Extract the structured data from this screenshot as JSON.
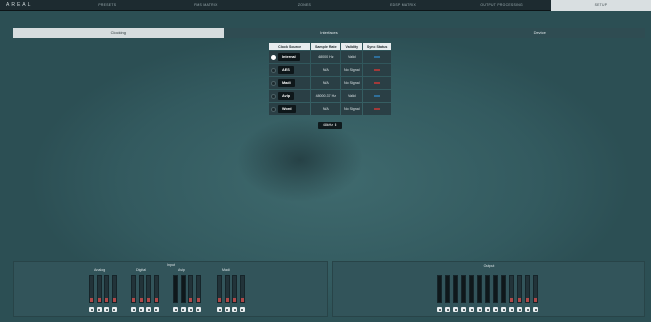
{
  "brand": "AREAL",
  "nav": {
    "tabs": [
      "PRESETS",
      "FMS MATRIX",
      "ZONES",
      "EDSP MATRIX",
      "OUTPUT PROCESSING",
      "SETUP"
    ],
    "active": "SETUP"
  },
  "subtabs": {
    "items": [
      "Clocking",
      "Interfaces",
      "Device"
    ],
    "active": "Clocking"
  },
  "clock_table": {
    "headers": [
      "Clock Source",
      "Sample Rate",
      "Validity",
      "Sync Status"
    ],
    "rows": [
      {
        "source": "Internal",
        "rate": "48000 Hz",
        "validity": "Valid",
        "selected": true,
        "sync": "ok"
      },
      {
        "source": "AES",
        "rate": "N/A",
        "validity": "No Signal",
        "selected": false,
        "sync": "bad"
      },
      {
        "source": "Madi",
        "rate": "N/A",
        "validity": "No Signal",
        "selected": false,
        "sync": "bad"
      },
      {
        "source": "Avip",
        "rate": "48000.37 Hz",
        "validity": "Valid",
        "selected": false,
        "sync": "ok"
      },
      {
        "source": "Word",
        "rate": "N/A",
        "validity": "No Signal",
        "selected": false,
        "sync": "bad"
      }
    ]
  },
  "rate_select": {
    "value": "48kHz",
    "chevron": "⇕"
  },
  "meters": {
    "input_title": "Input",
    "output_title": "Output",
    "groups": [
      {
        "label": "Analog",
        "count": 4
      },
      {
        "label": "Digital",
        "count": 4
      },
      {
        "label": "Avip",
        "count": 4
      },
      {
        "label": "Madi",
        "count": 4
      }
    ],
    "output_count": 13
  },
  "colors": {
    "accent": "#d9dfe1",
    "clip": "#b04848",
    "sync_ok": "#2f6f9a",
    "sync_bad": "#a23a3a"
  }
}
